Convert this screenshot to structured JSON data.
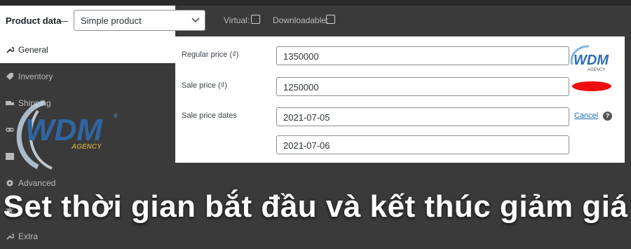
{
  "header": {
    "product_data_label": "Product data",
    "dash": "—",
    "product_type_value": "Simple product",
    "virtual_label": "Virtual:",
    "downloadable_label": "Downloadable:"
  },
  "sidebar": {
    "items": [
      {
        "label": "General",
        "icon": "wrench-icon"
      },
      {
        "label": "Inventory",
        "icon": "tag-icon"
      },
      {
        "label": "Shipping",
        "icon": "truck-icon"
      },
      {
        "label": "",
        "icon": "link-icon"
      },
      {
        "label": "",
        "icon": "list-icon"
      },
      {
        "label": "Advanced",
        "icon": "gear-icon"
      },
      {
        "label": "",
        "icon": "star-icon"
      },
      {
        "label": "Extra",
        "icon": "wrench-icon"
      }
    ]
  },
  "panel": {
    "regular_price_label": "Regular price (₫)",
    "regular_price_value": "1350000",
    "sale_price_label": "Sale price (₫)",
    "sale_price_value": "1250000",
    "sale_dates_label": "Sale price dates",
    "sale_date_from": "2021-07-05",
    "sale_date_to": "2021-07-06",
    "cancel_link": "Cancel",
    "help_glyph": "?"
  },
  "watermark": {
    "logo_text": "WDM",
    "agency_text": "AGENCY",
    "registered": "®"
  },
  "caption": "Set thời gian bắt đầu và kết thúc giảm giá",
  "colors": {
    "accent_blue": "#2271b1",
    "bg_dark": "#3a3a3a",
    "red_mark": "#ee0e0e"
  }
}
